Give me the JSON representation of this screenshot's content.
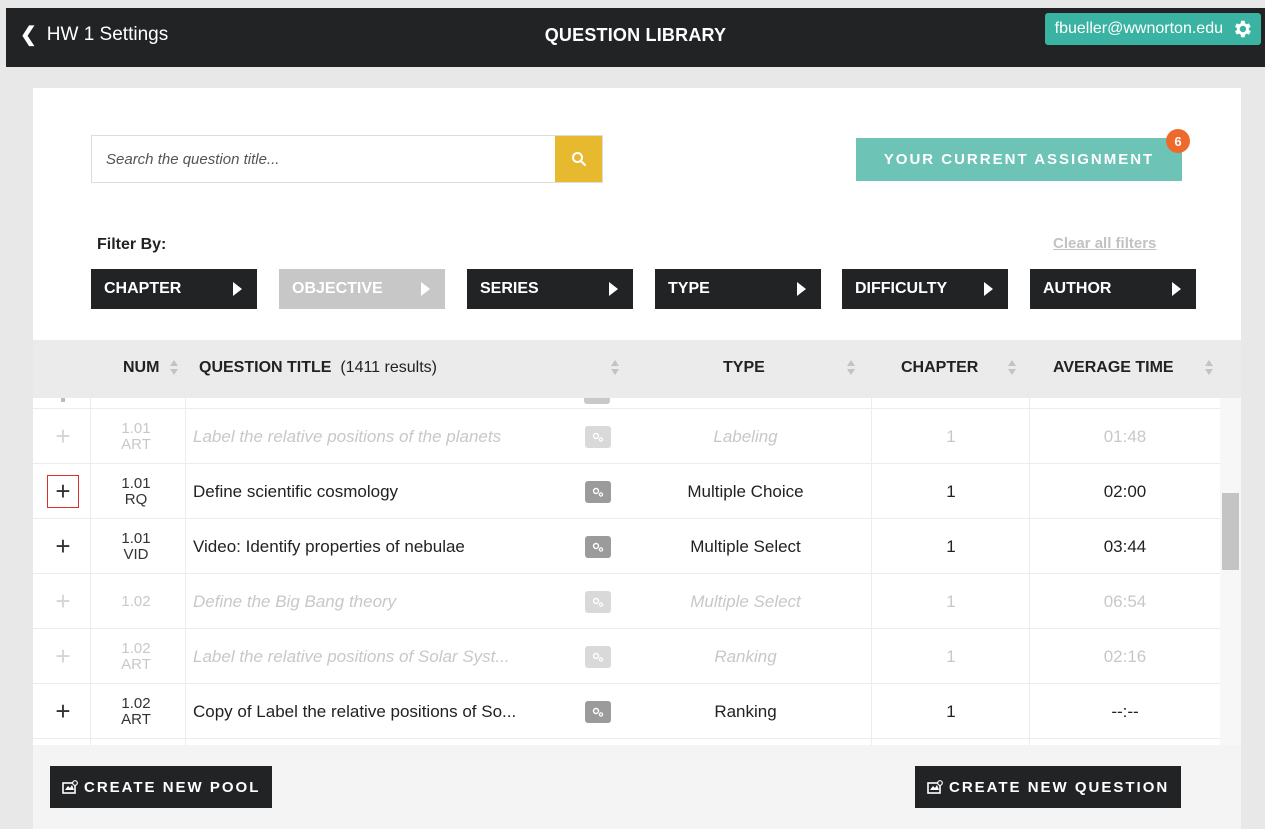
{
  "header": {
    "back_label": "HW 1 Settings",
    "title": "QUESTION LIBRARY",
    "user_email": "fbueller@wwnorton.edu"
  },
  "search": {
    "placeholder": "Search the question title..."
  },
  "assignment": {
    "label": "YOUR CURRENT ASSIGNMENT",
    "count": "6"
  },
  "filters": {
    "label": "Filter By:",
    "clear_label": "Clear all filters",
    "items": [
      {
        "label": "CHAPTER",
        "enabled": true
      },
      {
        "label": "OBJECTIVE",
        "enabled": false
      },
      {
        "label": "SERIES",
        "enabled": true
      },
      {
        "label": "TYPE",
        "enabled": true
      },
      {
        "label": "DIFFICULTY",
        "enabled": true
      },
      {
        "label": "AUTHOR",
        "enabled": true
      }
    ]
  },
  "table": {
    "columns": {
      "num": "NUM",
      "title": "QUESTION TITLE",
      "results": "(1411 results)",
      "type": "TYPE",
      "chapter": "CHAPTER",
      "avg_time": "AVERAGE TIME"
    },
    "rows": [
      {
        "num": "1.01",
        "kind": "ART",
        "title": "Label the relative positions of the planets",
        "type": "Labeling",
        "chapter": "1",
        "time": "01:48",
        "muted": true
      },
      {
        "num": "1.01",
        "kind": "RQ",
        "title": "Define scientific cosmology",
        "type": "Multiple Choice",
        "chapter": "1",
        "time": "02:00",
        "muted": false,
        "highlighted": true
      },
      {
        "num": "1.01",
        "kind": "VID",
        "title": "Video: Identify properties of nebulae",
        "type": "Multiple Select",
        "chapter": "1",
        "time": "03:44",
        "muted": false
      },
      {
        "num": "1.02",
        "kind": "",
        "title": "Define the Big Bang theory",
        "type": "Multiple Select",
        "chapter": "1",
        "time": "06:54",
        "muted": true
      },
      {
        "num": "1.02",
        "kind": "ART",
        "title": "Label the relative positions of Solar Syst...",
        "type": "Ranking",
        "chapter": "1",
        "time": "02:16",
        "muted": true
      },
      {
        "num": "1.02",
        "kind": "ART",
        "title": "Copy of Label the relative positions of So...",
        "type": "Ranking",
        "chapter": "1",
        "time": "--:--",
        "muted": false
      }
    ]
  },
  "footer": {
    "create_pool": "CREATE NEW POOL",
    "create_question": "CREATE NEW QUESTION"
  },
  "colors": {
    "dark": "#222325",
    "accent_teal": "#3bb3a3",
    "assignment_button": "#6cc3b6",
    "search_button": "#e6b92f",
    "badge": "#ee6a2c",
    "highlight": "#d9302c"
  }
}
